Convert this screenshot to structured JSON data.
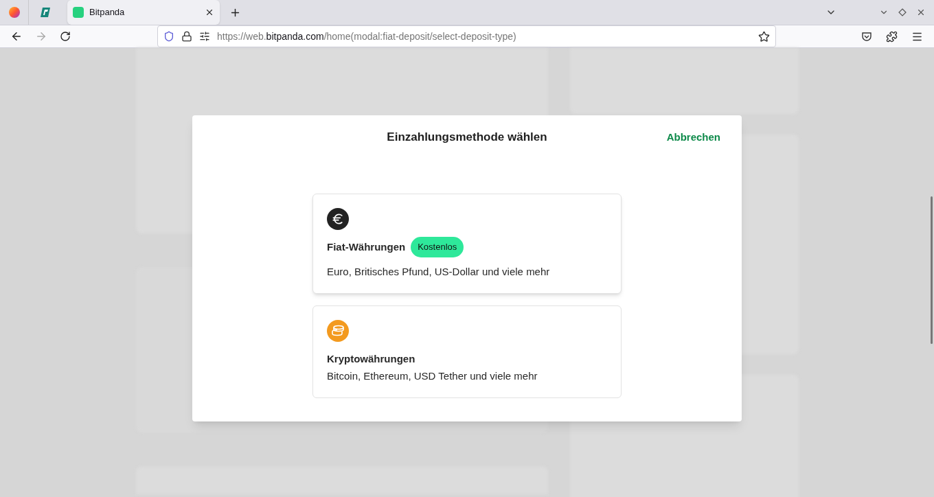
{
  "browser": {
    "tabs": [
      {
        "label": "Bitpanda",
        "selected": true
      }
    ],
    "url_prefix": "https://web.",
    "url_domain": "bitpanda.com",
    "url_path": "/home(modal:fiat-deposit/select-deposit-type)"
  },
  "modal": {
    "title": "Einzahlungsmethode wählen",
    "cancel": "Abbrechen",
    "options": [
      {
        "kind": "fiat",
        "title": "Fiat-Währungen",
        "badge": "Kostenlos",
        "description": "Euro, Britisches Pfund, US-Dollar und viele mehr"
      },
      {
        "kind": "crypto",
        "title": "Kryptowährungen",
        "description": "Bitcoin, Ethereum, USD Tether und viele mehr"
      }
    ]
  }
}
